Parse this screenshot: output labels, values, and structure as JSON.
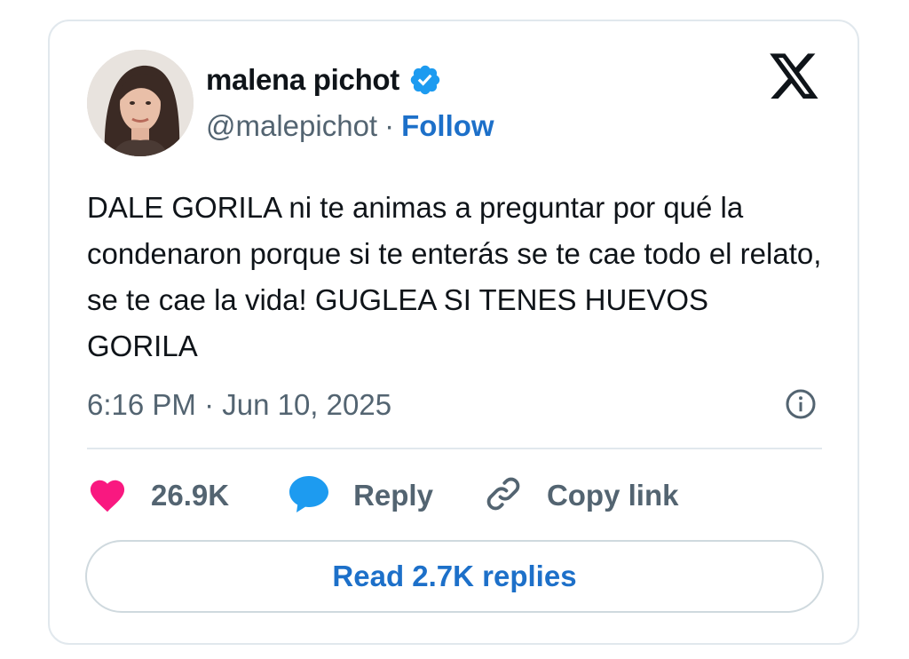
{
  "author": {
    "name": "malena pichot",
    "handle": "@malepichot",
    "separator": "·",
    "follow_label": "Follow",
    "verified": true
  },
  "tweet": {
    "text": "DALE GORILA ni te animas a preguntar por qué la condenaron porque si te enterás se te cae todo el relato, se te cae la vida! GUGLEA SI TENES HUEVOS GORILA",
    "timestamp": "6:16 PM · Jun 10, 2025"
  },
  "actions": {
    "likes_count": "26.9K",
    "reply_label": "Reply",
    "copy_link_label": "Copy link"
  },
  "footer": {
    "read_replies_label": "Read 2.7K replies"
  },
  "colors": {
    "accent": "#1d70c9",
    "verified_badge": "#1d9bf0",
    "like_heart": "#f91880",
    "reply_bubble": "#1d9bf0",
    "muted_text": "#536471",
    "border": "#e1e8ed"
  },
  "icons": {
    "verified": "verified-badge-icon",
    "platform": "x-logo-icon",
    "info": "info-icon",
    "like": "heart-icon",
    "reply": "speech-bubble-icon",
    "copy_link": "link-icon"
  }
}
